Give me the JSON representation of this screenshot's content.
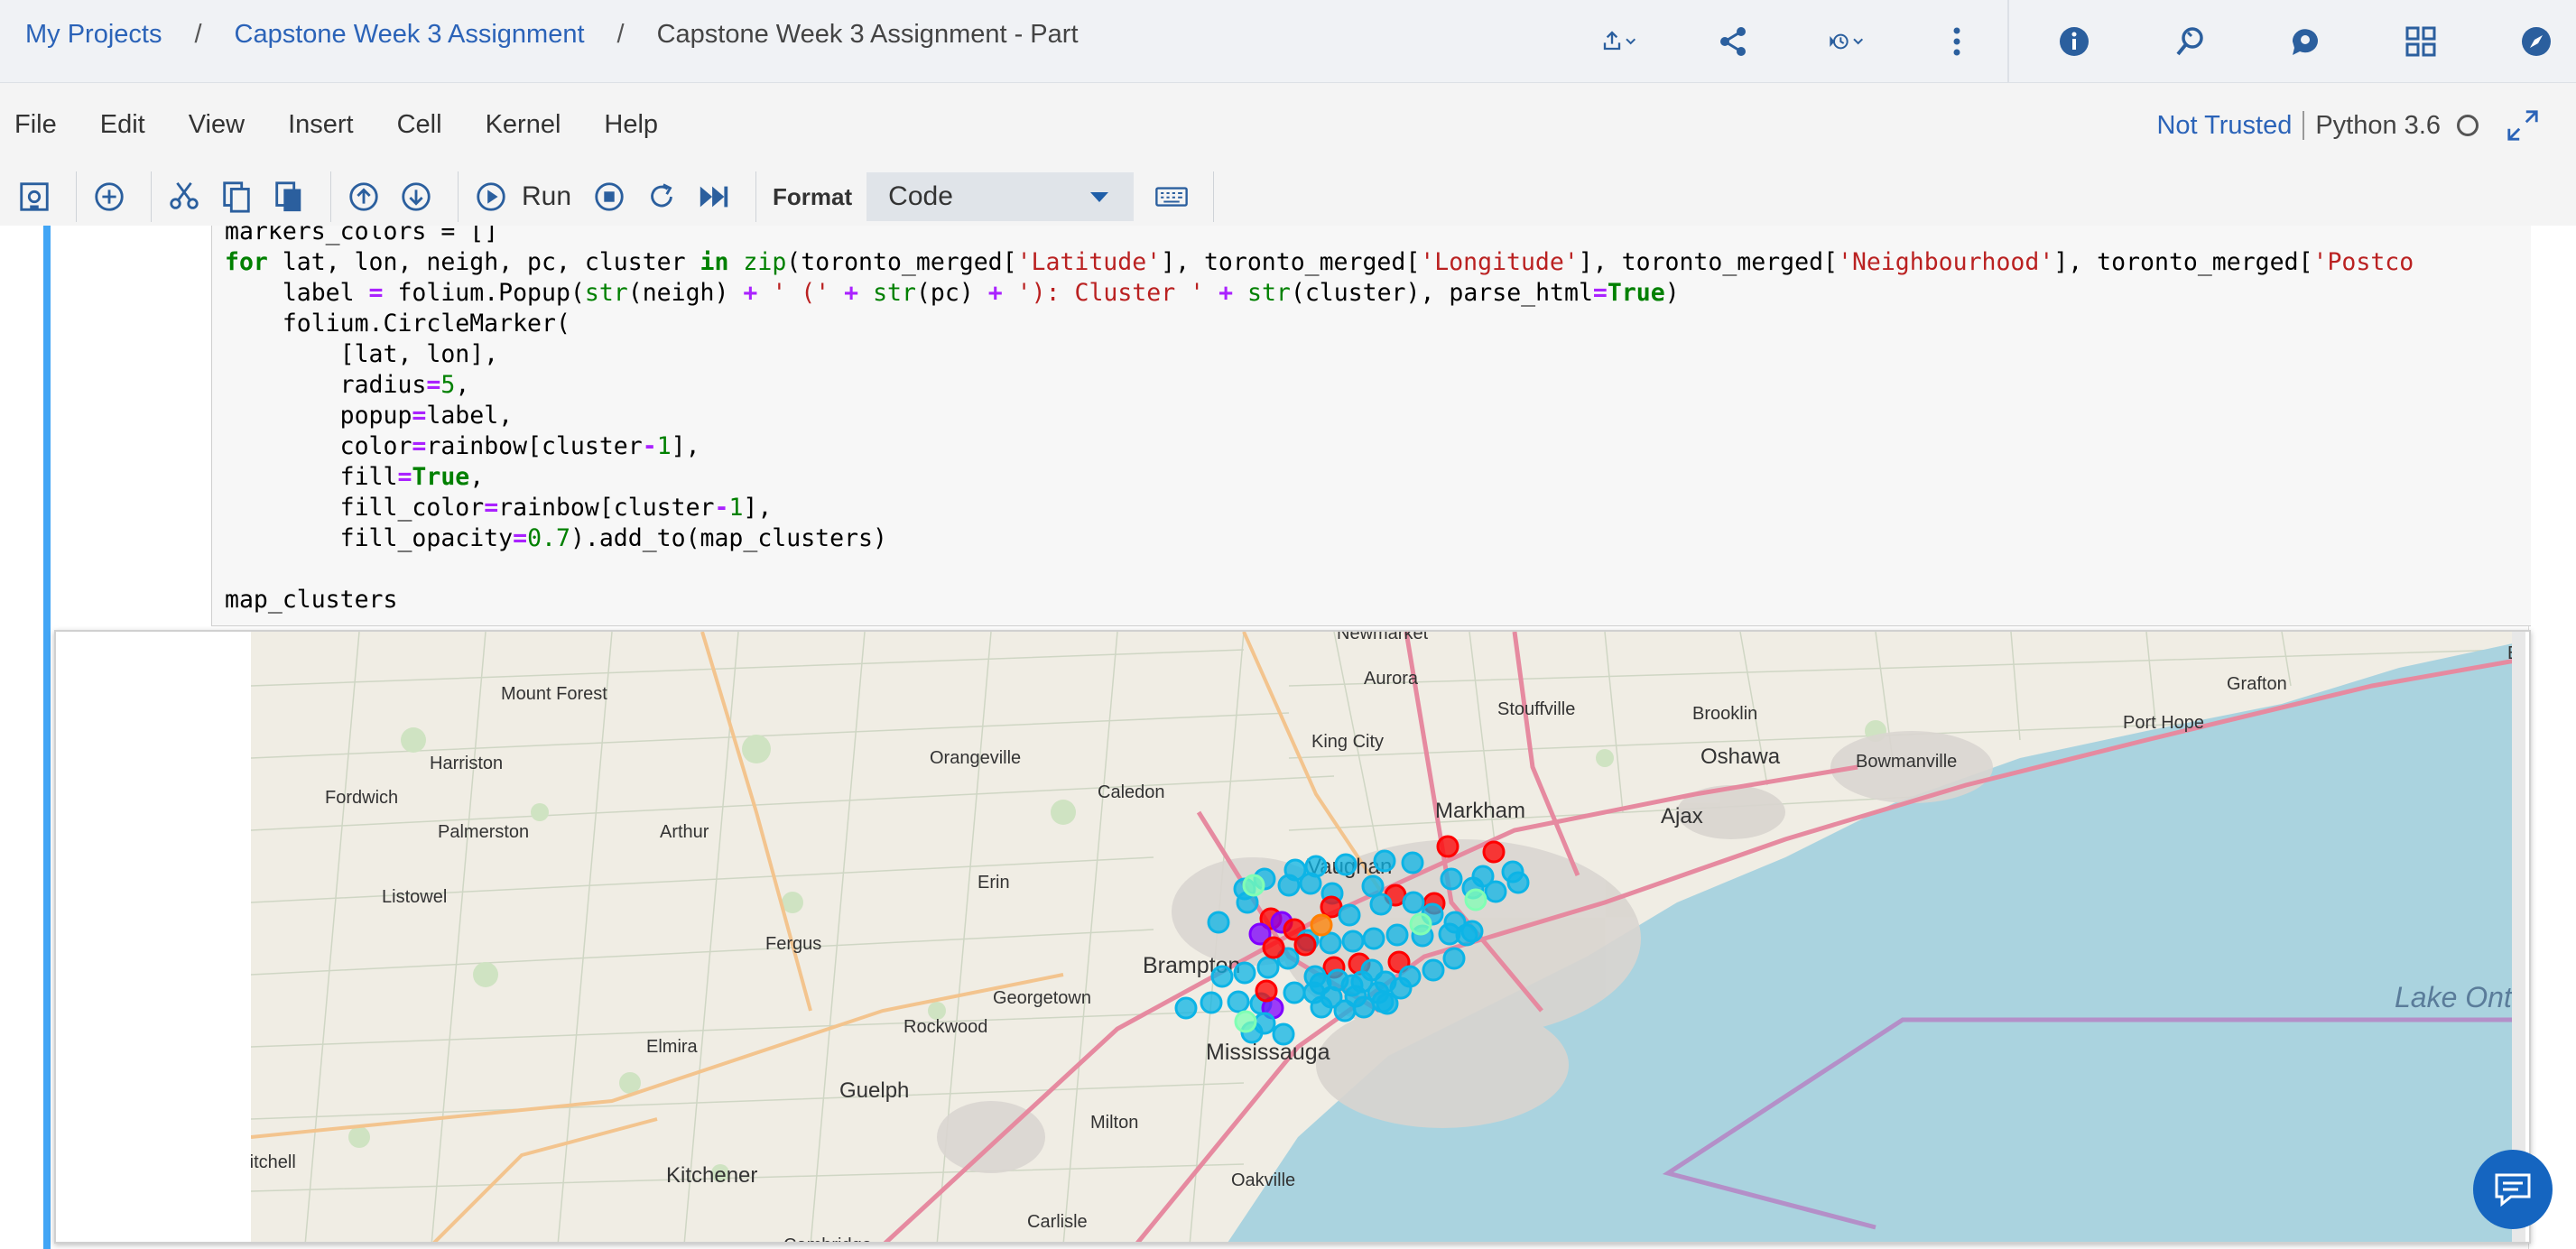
{
  "breadcrumb": {
    "root": "My Projects",
    "project": "Capstone Week 3 Assignment",
    "notebook": "Capstone Week 3 Assignment - Part",
    "separator": "/"
  },
  "top_icons": [
    "upload-icon",
    "share-icon",
    "version-history-icon",
    "more-icon",
    "info-icon",
    "find-replace-icon",
    "comments-icon",
    "dashboard-icon",
    "compass-icon"
  ],
  "menu": {
    "items": [
      "File",
      "Edit",
      "View",
      "Insert",
      "Cell",
      "Kernel",
      "Help"
    ]
  },
  "kernel": {
    "trust": "Not Trusted",
    "name": "Python 3.6"
  },
  "toolbar": {
    "run_label": "Run",
    "format_label": "Format",
    "format_value": "Code"
  },
  "code_lines": [
    "markers_colors = []",
    "for lat, lon, neigh, pc, cluster in zip(toronto_merged['Latitude'], toronto_merged['Longitude'], toronto_merged['Neighbourhood'], toronto_merged['Postco",
    "    label = folium.Popup(str(neigh) + ' (' + str(pc) + '): Cluster ' + str(cluster), parse_html=True)",
    "    folium.CircleMarker(",
    "        [lat, lon],",
    "        radius=5,",
    "        popup=label,",
    "        color=rainbow[cluster-1],",
    "        fill=True,",
    "        fill_color=rainbow[cluster-1],",
    "        fill_opacity=0.7).add_to(map_clusters)",
    "",
    "map_clusters"
  ],
  "map": {
    "places": [
      "Newmarket",
      "Aurora",
      "Mount Forest",
      "Stouffville",
      "Brooklin",
      "Grafton",
      "Port Hope",
      "Oshawa",
      "Bowmanville",
      "Harriston",
      "Orangeville",
      "King City",
      "Fordwich",
      "Caledon",
      "Markham",
      "Ajax",
      "Palmerston",
      "Arthur",
      "Vaughan",
      "Erin",
      "Listowel",
      "Brampton",
      "Fergus",
      "Georgetown",
      "Rockwood",
      "Mississauga",
      "Elmira",
      "Guelph",
      "Milton",
      "Kitchener",
      "Oakville",
      "Carlisle",
      "Cambridge",
      "Mitchell",
      "Lake Ontario",
      "Brighton"
    ],
    "colors": {
      "water": "#aad3df",
      "land": "#f0ede4",
      "cluster_blue": "#0cb4e6",
      "cluster_red": "#ff0000",
      "cluster_purple": "#8000ff",
      "cluster_green": "#80ffb4",
      "cluster_orange": "#ff8000"
    }
  }
}
